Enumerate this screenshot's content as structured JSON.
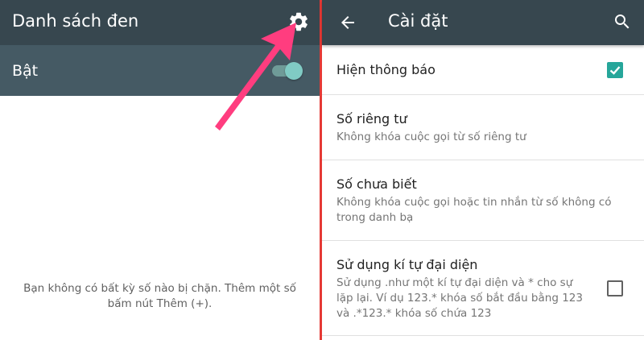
{
  "left": {
    "title": "Danh sách đen",
    "toggle_label": "Bật",
    "toggle_on": true,
    "empty_message": "Bạn không có bất kỳ số nào bị chặn. Thêm một số bấm nút Thêm (+).",
    "icons": {
      "settings": "gear-icon",
      "annotation": "pink-arrow"
    }
  },
  "right": {
    "title": "Cài đặt",
    "icons": {
      "back": "back-arrow-icon",
      "search": "search-icon"
    },
    "settings": [
      {
        "title": "Hiện thông báo",
        "subtitle": "",
        "checked": true
      },
      {
        "title": "Số riêng tư",
        "subtitle": "Không khóa cuộc gọi từ số riêng tư"
      },
      {
        "title": "Số chưa biết",
        "subtitle": "Không khóa cuộc gọi hoặc tin nhắn từ số không có trong danh bạ"
      },
      {
        "title": "Sử dụng kí tự đại diện",
        "subtitle": "Sử dụng .như một kí tự đại diện và * cho sự lặp lại. Ví dụ 123.* khóa số bắt đầu bằng 123 và .*123.* khóa số chứa 123",
        "checked": false
      }
    ]
  },
  "colors": {
    "appbar": "#37474f",
    "toggle_bar": "#455a64",
    "accent": "#26a69a",
    "divider": "#e53935",
    "arrow": "#ff3d7f"
  }
}
